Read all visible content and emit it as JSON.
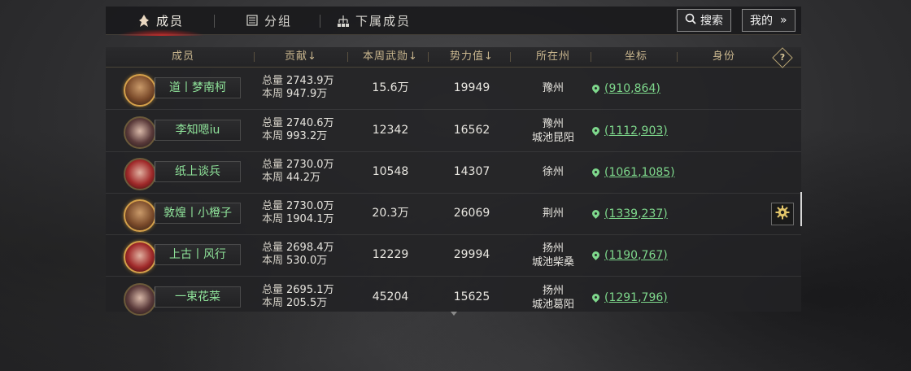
{
  "tabs": [
    {
      "label": "成员",
      "icon": "member-flame-icon",
      "active": true
    },
    {
      "label": "分组",
      "icon": "group-list-icon",
      "active": false
    },
    {
      "label": "下属成员",
      "icon": "subordinate-tree-icon",
      "active": false
    }
  ],
  "top_buttons": {
    "search_label": "搜索",
    "mine_label": "我的",
    "mine_arrow": "»"
  },
  "table": {
    "headers": {
      "member": "成员",
      "contribution": "贡献↓",
      "weekly_merit": "本周武勋↓",
      "power": "势力值↓",
      "state": "所在州",
      "coordinates": "坐标",
      "identity": "身份",
      "help": "?"
    },
    "rows": [
      {
        "name": "道丨梦南柯",
        "total_label": "总量",
        "total": "2743.9万",
        "week_label": "本周",
        "week": "947.9万",
        "merit": "15.6万",
        "power": "19949",
        "state_line1": "豫州",
        "state_line2": "",
        "coord": "(910,864)"
      },
      {
        "name": "李知嗯iu",
        "total_label": "总量",
        "total": "2740.6万",
        "week_label": "本周",
        "week": "993.2万",
        "merit": "12342",
        "power": "16562",
        "state_line1": "豫州",
        "state_line2": "城池昆阳",
        "coord": "(1112,903)"
      },
      {
        "name": "纸上谈兵",
        "total_label": "总量",
        "total": "2730.0万",
        "week_label": "本周",
        "week": "44.2万",
        "merit": "10548",
        "power": "14307",
        "state_line1": "徐州",
        "state_line2": "",
        "coord": "(1061,1085)"
      },
      {
        "name": "敦煌丨小橙子",
        "total_label": "总量",
        "total": "2730.0万",
        "week_label": "本周",
        "week": "1904.1万",
        "merit": "20.3万",
        "power": "26069",
        "state_line1": "荆州",
        "state_line2": "",
        "coord": "(1339,237)"
      },
      {
        "name": "上古丨风行",
        "total_label": "总量",
        "total": "2698.4万",
        "week_label": "本周",
        "week": "530.0万",
        "merit": "12229",
        "power": "29994",
        "state_line1": "扬州",
        "state_line2": "城池柴桑",
        "coord": "(1190,767)"
      },
      {
        "name": "一束花菜",
        "total_label": "总量",
        "total": "2695.1万",
        "week_label": "本周",
        "week": "205.5万",
        "merit": "45204",
        "power": "15625",
        "state_line1": "扬州",
        "state_line2": "城池葛阳",
        "coord": "(1291,796)"
      }
    ]
  },
  "colors": {
    "name_green": "#8fe39a",
    "coord_green": "#7ed88c",
    "header_gold": "#c9b68e",
    "active_tab_glow": "#d22828"
  }
}
